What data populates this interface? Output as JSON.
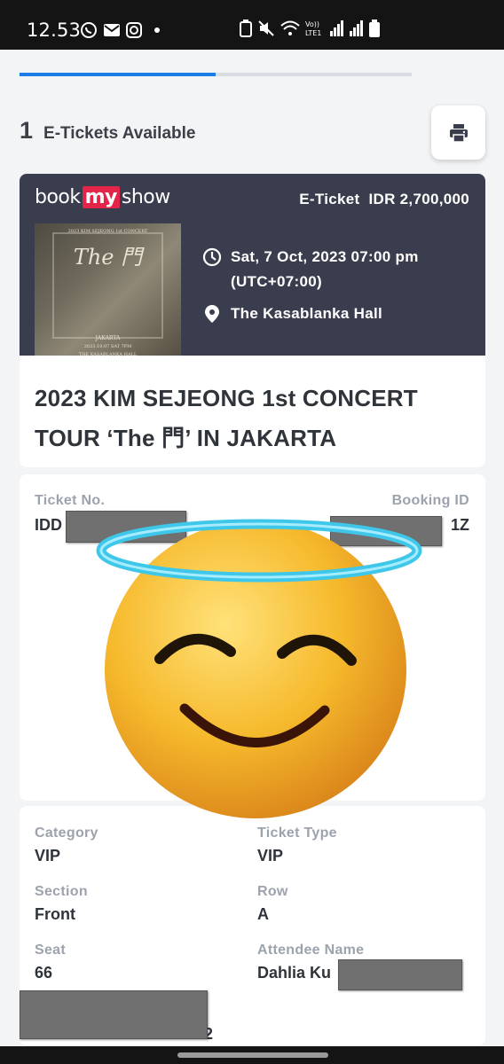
{
  "status_bar": {
    "time": "12.53",
    "icons_left": [
      "whatsapp-icon",
      "mail-icon",
      "instagram-icon"
    ],
    "icons_right": [
      "battery-saver-icon",
      "mute-icon",
      "wifi-icon",
      "volte-icon",
      "signal-icon",
      "signal-icon",
      "battery-icon"
    ],
    "network_label": "Vo)\nLTE1"
  },
  "tabs": {
    "active_index": 0,
    "count": 2
  },
  "tickets_available": {
    "count": "1",
    "label": "E-Tickets Available"
  },
  "print_button": {
    "icon": "printer-icon"
  },
  "ticket": {
    "brand": {
      "part1": "book",
      "part2": "my",
      "part3": "show"
    },
    "type_label": "E-Ticket",
    "price": "IDR 2,700,000",
    "poster": {
      "line1": "2023 KIM SEJEONG 1st CONCERT",
      "line2": "The 門",
      "line3": "JAKARTA",
      "line4": "2023.10.07 SAT 7PM",
      "line5": "THE KASABLANKA HALL"
    },
    "date_line1": "Sat, 7 Oct, 2023 07:00 pm",
    "date_line2": "(UTC+07:00)",
    "venue": "The Kasablanka Hall",
    "title_line1": "2023 KIM SEJEONG 1st CONCERT",
    "title_line2": "TOUR ‘The 門’ IN JAKARTA"
  },
  "ids": {
    "ticket_no_label": "Ticket No.",
    "ticket_no_value": "IDD",
    "booking_id_label": "Booking ID",
    "booking_id_value": "1Z"
  },
  "details": {
    "category_label": "Category",
    "category_value": "VIP",
    "ticket_type_label": "Ticket Type",
    "ticket_type_value": "VIP",
    "section_label": "Section",
    "section_value": "Front",
    "row_label": "Row",
    "row_value": "A",
    "seat_label": "Seat",
    "seat_value": "66",
    "attendee_label": "Attendee Name",
    "attendee_value": "Dahlia Ku",
    "trailing_digit": "2"
  },
  "colors": {
    "accent": "#1e7ce8",
    "header_bg": "#3a3d4d",
    "brand_red": "#e4254a",
    "redaction": "#707070",
    "halo": "#3fc7ea",
    "emoji_face": "#f6b92c"
  },
  "overlay": {
    "sticker": "smiling-face-with-halo-emoji"
  }
}
